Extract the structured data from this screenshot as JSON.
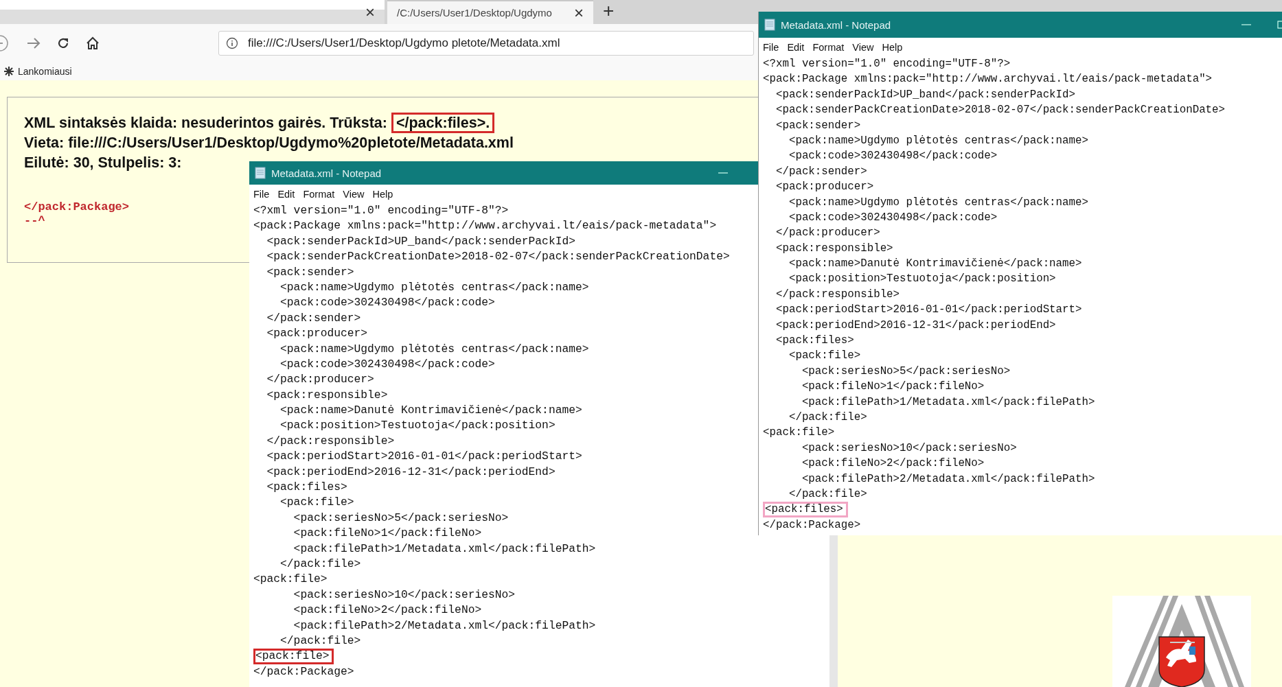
{
  "browser": {
    "tabs": [
      {
        "selected": false,
        "close": "×"
      },
      {
        "label": "/C:/Users/User1/Desktop/Ugdymo",
        "selected": true,
        "close": "×"
      }
    ],
    "new_tab": "+",
    "url": "file:///C:/Users/User1/Desktop/Ugdymo pletote/Metadata.xml",
    "bookmarks": [
      {
        "label": "Lankomiausi"
      }
    ]
  },
  "error": {
    "message": "XML sintaksės klaida: nesuderintos gairės. Trūksta:",
    "missing": "</pack:files>.",
    "location": "Vieta: file:///C:/Users/User1/Desktop/Ugdymo%20pletote/Metadata.xml",
    "position": "Eilutė: 30, Stulpelis: 3:",
    "source_line": "</pack:Package>",
    "pointer": "--^"
  },
  "notepads": [
    {
      "title": "Metadata.xml - Notepad",
      "color": "#d42a2a",
      "menu": [
        "File",
        "Edit",
        "Format",
        "View",
        "Help"
      ],
      "lines": [
        {
          "text": "<?xml version=\"1.0\" encoding=\"UTF-8\"?>",
          "marked": false
        },
        {
          "text": "<pack:Package xmlns:pack=\"http://www.archyvai.lt/eais/pack-metadata\">",
          "marked": false
        },
        {
          "text": "  <pack:senderPackId>UP_band</pack:senderPackId>",
          "marked": false
        },
        {
          "text": "  <pack:senderPackCreationDate>2018-02-07</pack:senderPackCreationDate>",
          "marked": false
        },
        {
          "text": "  <pack:sender>",
          "marked": false
        },
        {
          "text": "    <pack:name>Ugdymo plėtotės centras</pack:name>",
          "marked": false
        },
        {
          "text": "    <pack:code>302430498</pack:code>",
          "marked": false
        },
        {
          "text": "  </pack:sender>",
          "marked": false
        },
        {
          "text": "  <pack:producer>",
          "marked": false
        },
        {
          "text": "    <pack:name>Ugdymo plėtotės centras</pack:name>",
          "marked": false
        },
        {
          "text": "    <pack:code>302430498</pack:code>",
          "marked": false
        },
        {
          "text": "  </pack:producer>",
          "marked": false
        },
        {
          "text": "  <pack:responsible>",
          "marked": false
        },
        {
          "text": "    <pack:name>Danutė Kontrimavičienė</pack:name>",
          "marked": false
        },
        {
          "text": "    <pack:position>Testuotoja</pack:position>",
          "marked": false
        },
        {
          "text": "  </pack:responsible>",
          "marked": false
        },
        {
          "text": "  <pack:periodStart>2016-01-01</pack:periodStart>",
          "marked": false
        },
        {
          "text": "  <pack:periodEnd>2016-12-31</pack:periodEnd>",
          "marked": false
        },
        {
          "text": "  <pack:files>",
          "marked": false
        },
        {
          "text": "    <pack:file>",
          "marked": false
        },
        {
          "text": "      <pack:seriesNo>5</pack:seriesNo>",
          "marked": false
        },
        {
          "text": "      <pack:fileNo>1</pack:fileNo>",
          "marked": false
        },
        {
          "text": "      <pack:filePath>1/Metadata.xml</pack:filePath>",
          "marked": false
        },
        {
          "text": "    </pack:file>",
          "marked": false
        },
        {
          "text": "<pack:file>",
          "marked": false
        },
        {
          "text": "      <pack:seriesNo>10</pack:seriesNo>",
          "marked": false
        },
        {
          "text": "      <pack:fileNo>2</pack:fileNo>",
          "marked": false
        },
        {
          "text": "      <pack:filePath>2/Metadata.xml</pack:filePath>",
          "marked": false
        },
        {
          "text": "    </pack:file>",
          "marked": false
        },
        {
          "text": "<pack:file>",
          "marked": true
        },
        {
          "text": "</pack:Package>",
          "marked": false
        }
      ]
    },
    {
      "title": "Metadata.xml - Notepad",
      "color": "#f2a6c4",
      "menu": [
        "File",
        "Edit",
        "Format",
        "View",
        "Help"
      ],
      "lines": [
        {
          "text": "<?xml version=\"1.0\" encoding=\"UTF-8\"?>",
          "marked": false
        },
        {
          "text": "<pack:Package xmlns:pack=\"http://www.archyvai.lt/eais/pack-metadata\">",
          "marked": false
        },
        {
          "text": "  <pack:senderPackId>UP_band</pack:senderPackId>",
          "marked": false
        },
        {
          "text": "  <pack:senderPackCreationDate>2018-02-07</pack:senderPackCreationDate>",
          "marked": false
        },
        {
          "text": "  <pack:sender>",
          "marked": false
        },
        {
          "text": "    <pack:name>Ugdymo plėtotės centras</pack:name>",
          "marked": false
        },
        {
          "text": "    <pack:code>302430498</pack:code>",
          "marked": false
        },
        {
          "text": "  </pack:sender>",
          "marked": false
        },
        {
          "text": "  <pack:producer>",
          "marked": false
        },
        {
          "text": "    <pack:name>Ugdymo plėtotės centras</pack:name>",
          "marked": false
        },
        {
          "text": "    <pack:code>302430498</pack:code>",
          "marked": false
        },
        {
          "text": "  </pack:producer>",
          "marked": false
        },
        {
          "text": "  <pack:responsible>",
          "marked": false
        },
        {
          "text": "    <pack:name>Danutė Kontrimavičienė</pack:name>",
          "marked": false
        },
        {
          "text": "    <pack:position>Testuotoja</pack:position>",
          "marked": false
        },
        {
          "text": "  </pack:responsible>",
          "marked": false
        },
        {
          "text": "  <pack:periodStart>2016-01-01</pack:periodStart>",
          "marked": false
        },
        {
          "text": "  <pack:periodEnd>2016-12-31</pack:periodEnd>",
          "marked": false
        },
        {
          "text": "  <pack:files>",
          "marked": false
        },
        {
          "text": "    <pack:file>",
          "marked": false
        },
        {
          "text": "      <pack:seriesNo>5</pack:seriesNo>",
          "marked": false
        },
        {
          "text": "      <pack:fileNo>1</pack:fileNo>",
          "marked": false
        },
        {
          "text": "      <pack:filePath>1/Metadata.xml</pack:filePath>",
          "marked": false
        },
        {
          "text": "    </pack:file>",
          "marked": false
        },
        {
          "text": "<pack:file>",
          "marked": false
        },
        {
          "text": "      <pack:seriesNo>10</pack:seriesNo>",
          "marked": false
        },
        {
          "text": "      <pack:fileNo>2</pack:fileNo>",
          "marked": false
        },
        {
          "text": "      <pack:filePath>2/Metadata.xml</pack:filePath>",
          "marked": false
        },
        {
          "text": "    </pack:file>",
          "marked": false
        },
        {
          "text": "<pack:files>",
          "marked": true
        },
        {
          "text": "</pack:Package>",
          "marked": false
        }
      ]
    }
  ]
}
